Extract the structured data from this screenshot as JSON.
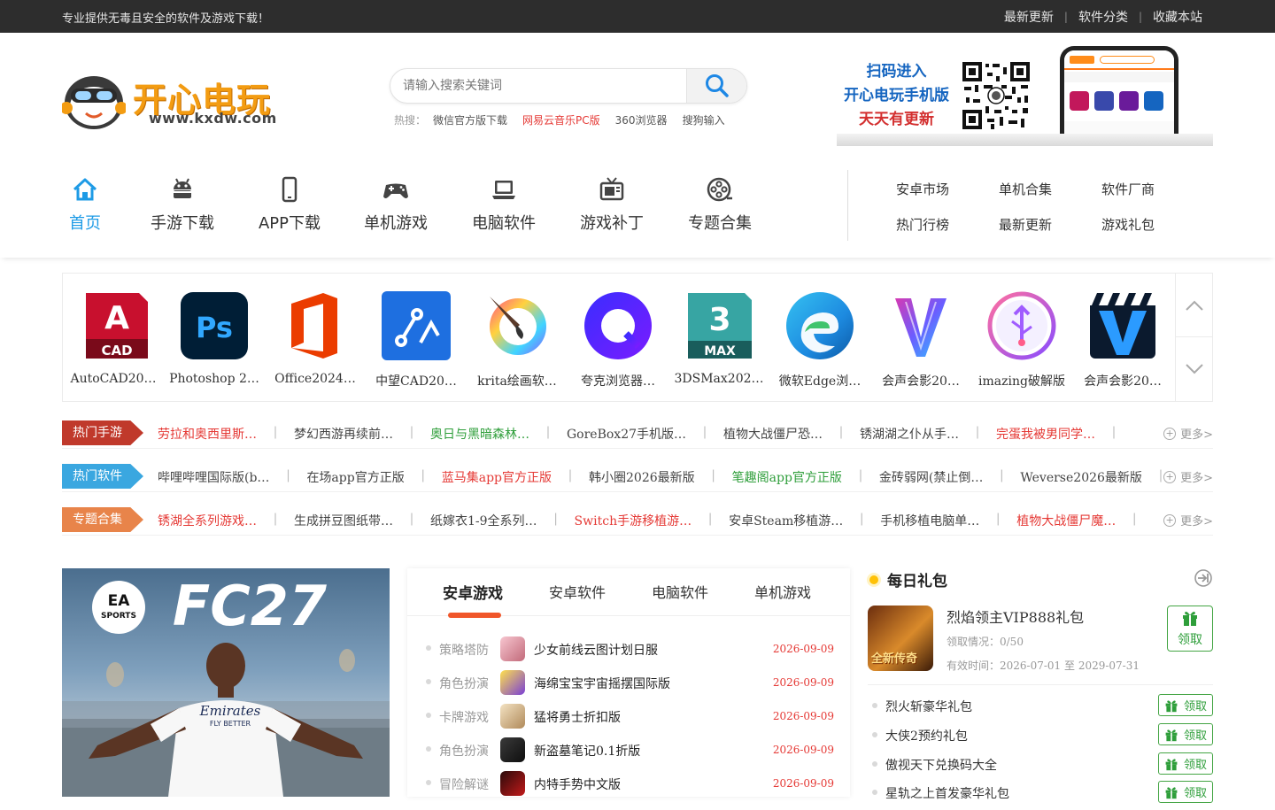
{
  "topbar": {
    "slogan": "专业提供无毒且安全的软件及游戏下载！",
    "links": [
      "最新更新",
      "软件分类",
      "收藏本站"
    ]
  },
  "logo": {
    "name": "开心电玩",
    "url": "www.kxdw.com"
  },
  "search": {
    "placeholder": "请输入搜索关键词",
    "hot_label": "热搜：",
    "hot": [
      "微信官方版下载",
      "网易云音乐PC版",
      "360浏览器",
      "搜狗输入"
    ]
  },
  "qr_banner": {
    "line1": "扫码进入",
    "line2": "开心电玩手机版",
    "line3": "天天有更新"
  },
  "nav": {
    "items": [
      {
        "label": "首页",
        "icon": "home-icon"
      },
      {
        "label": "手游下载",
        "icon": "android-icon"
      },
      {
        "label": "APP下载",
        "icon": "phone-icon"
      },
      {
        "label": "单机游戏",
        "icon": "gamepad-icon"
      },
      {
        "label": "电脑软件",
        "icon": "laptop-icon"
      },
      {
        "label": "游戏补丁",
        "icon": "tv-icon"
      },
      {
        "label": "专题合集",
        "icon": "film-icon"
      }
    ],
    "sub": [
      "安卓市场",
      "单机合集",
      "软件厂商",
      "热门行榜",
      "最新更新",
      "游戏礼包"
    ]
  },
  "apps": [
    {
      "label": "AutoCAD20…"
    },
    {
      "label": "Photoshop 2…"
    },
    {
      "label": "Office2024…"
    },
    {
      "label": "中望CAD20…"
    },
    {
      "label": "krita绘画软…"
    },
    {
      "label": "夸克浏览器…"
    },
    {
      "label": "3DSMax202…"
    },
    {
      "label": "微软Edge浏…"
    },
    {
      "label": "会声会影20…"
    },
    {
      "label": "imazing破解版"
    },
    {
      "label": "会声会影20…"
    }
  ],
  "rows": [
    {
      "tag": "热门手游",
      "color": "#c0392b",
      "links": [
        "劳拉和奥西里斯…",
        "梦幻西游再续前…",
        "奥日与黑暗森林…",
        "GoreBox27手机版…",
        "植物大战僵尸恐…",
        "锈湖湖之仆从手…",
        "完蛋我被男同学…"
      ]
    },
    {
      "tag": "热门软件",
      "color": "#3aa7e0",
      "links": [
        "哔哩哔哩国际版(b…",
        "在场app官方正版",
        "蓝马集app官方正版",
        "韩小圈2026最新版",
        "笔趣阁app官方正版",
        "金砖弱网(禁止倒…",
        "Weverse2026最新版"
      ]
    },
    {
      "tag": "专题合集",
      "color": "#e8844a",
      "links": [
        "锈湖全系列游戏…",
        "生成拼豆图纸带…",
        "纸嫁衣1-9全系列…",
        "Switch手游移植游…",
        "安卓Steam移植游…",
        "手机移植电脑单…",
        "植物大战僵尸魔…"
      ]
    }
  ],
  "more_label": "更多>",
  "poster": {
    "brand": "EA SPORTS",
    "title": "FC27",
    "shirt": "Emirates",
    "shirt_sub": "FLY BETTER"
  },
  "tabs": [
    "安卓游戏",
    "安卓软件",
    "电脑软件",
    "单机游戏"
  ],
  "games": [
    {
      "cat": "策略塔防",
      "name": "少女前线云图计划日服",
      "date": "2026-09-09"
    },
    {
      "cat": "角色扮演",
      "name": "海绵宝宝宇宙摇摆国际版",
      "date": "2026-09-09"
    },
    {
      "cat": "卡牌游戏",
      "name": "猛将勇士折扣版",
      "date": "2026-09-09"
    },
    {
      "cat": "角色扮演",
      "name": "新盗墓笔记0.1折版",
      "date": "2026-09-09"
    },
    {
      "cat": "冒险解谜",
      "name": "内特手势中文版",
      "date": "2026-09-09"
    }
  ],
  "gift": {
    "title": "每日礼包",
    "featured": {
      "thumb_text": "全新传奇",
      "name": "烈焰领主VIP888礼包",
      "claimed": "领取情况：0/50",
      "valid": "有效时间：2026-07-01 至 2029-07-31",
      "button": "领取"
    },
    "items": [
      {
        "name": "烈火斩豪华礼包",
        "button": "领取"
      },
      {
        "name": "大侠2预约礼包",
        "button": "领取"
      },
      {
        "name": "傲视天下兑换码大全",
        "button": "领取"
      },
      {
        "name": "星轨之上首发豪华礼包",
        "button": "领取"
      }
    ]
  }
}
